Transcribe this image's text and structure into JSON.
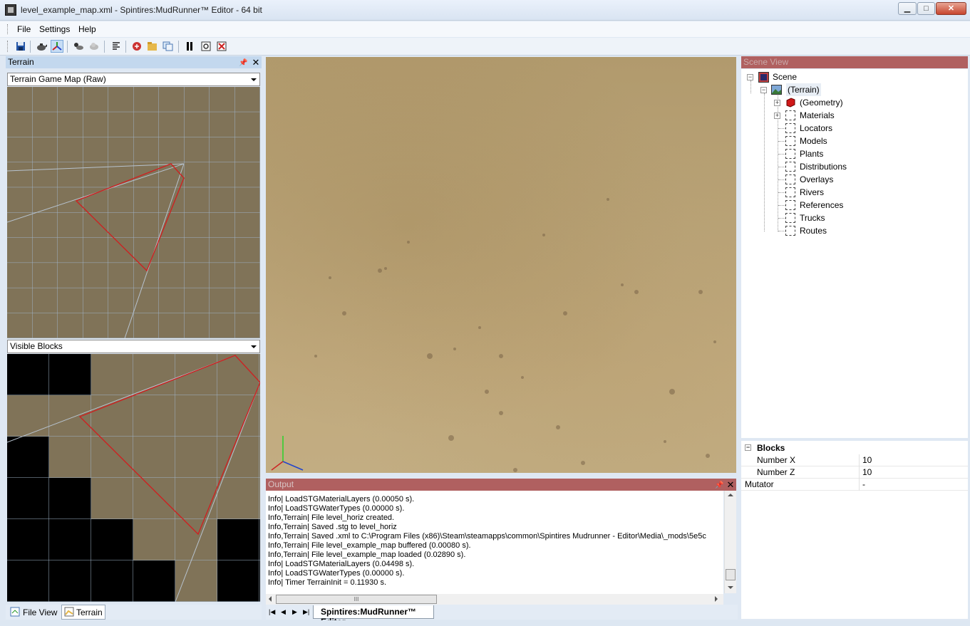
{
  "window": {
    "title": "level_example_map.xml - Spintires:MudRunner™ Editor - 64 bit",
    "minimize": "▁",
    "maximize": "□",
    "close": "✕"
  },
  "menu": [
    "File",
    "Settings",
    "Help"
  ],
  "terrain_panel": {
    "title": "Terrain",
    "map_combo": "Terrain Game Map (Raw)",
    "blocks_combo": "Visible Blocks",
    "bottom_tabs": [
      "File View",
      "Terrain"
    ]
  },
  "output_panel": {
    "title": "Output",
    "lines": [
      "Info| LoadSTGMaterialLayers (0.00050 s).",
      "Info| LoadSTGWaterTypes (0.00000 s).",
      "Info,Terrain| File level_horiz created.",
      "Info,Terrain| Saved .stg to level_horiz",
      "Info,Terrain| Saved .xml to C:\\Program Files (x86)\\Steam\\steamapps\\common\\Spintires Mudrunner - Editor\\Media\\_mods\\5e5c",
      "Info,Terrain| File level_example_map buffered (0.00080 s).",
      "Info,Terrain| File level_example_map loaded (0.02890 s).",
      "Info| LoadSTGMaterialLayers (0.04498 s).",
      "Info| LoadSTGWaterTypes (0.00000 s).",
      "Info| Timer TerrainInit = 0.11930 s."
    ],
    "hscroll_grip": "III"
  },
  "document_tab": "Spintires:MudRunner™ Editor",
  "scene_view": {
    "title": "Scene View",
    "root": "Scene",
    "terrain": "(Terrain)",
    "geometry": "(Geometry)",
    "items": [
      "Materials",
      "Locators",
      "Models",
      "Plants",
      "Distributions",
      "Overlays",
      "Rivers",
      "References",
      "Trucks",
      "Routes"
    ]
  },
  "properties": {
    "section": "Blocks",
    "rows": [
      {
        "name": "Number X",
        "value": "10"
      },
      {
        "name": "Number Z",
        "value": "10"
      },
      {
        "name": "Mutator",
        "value": "-"
      }
    ]
  },
  "colors": {
    "terrain_fill": "#807358",
    "frustum": "#cc2222",
    "grid": "#9fb3c8",
    "viewport_ground": "#b9a377",
    "panel_header_blue": "#c3d8ee",
    "panel_header_red": "#b06060"
  }
}
